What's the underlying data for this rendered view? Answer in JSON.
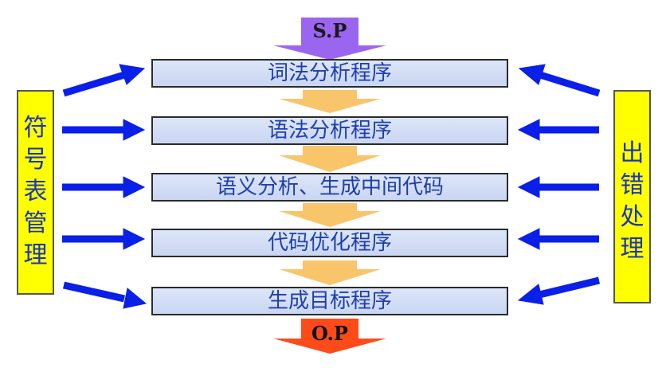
{
  "input_label": "S.P",
  "output_label": "O.P",
  "phases": [
    "词法分析程序",
    "语法分析程序",
    "语义分析、生成中间代码",
    "代码优化程序",
    "生成目标程序"
  ],
  "left_box": {
    "chars": [
      "符",
      "号",
      "表",
      "管",
      "理"
    ]
  },
  "right_box": {
    "chars": [
      "出",
      "错",
      "处",
      "理"
    ]
  },
  "colors": {
    "phase_text": "#1f3fb0",
    "side_fill": "#ffff00",
    "side_text": "#1a35b8",
    "blue_arrow": "#0a1fe8",
    "input_arrow": "#9b66ef",
    "flow_arrow": "#f9c56b",
    "output_arrow": "#ff4a1a"
  }
}
